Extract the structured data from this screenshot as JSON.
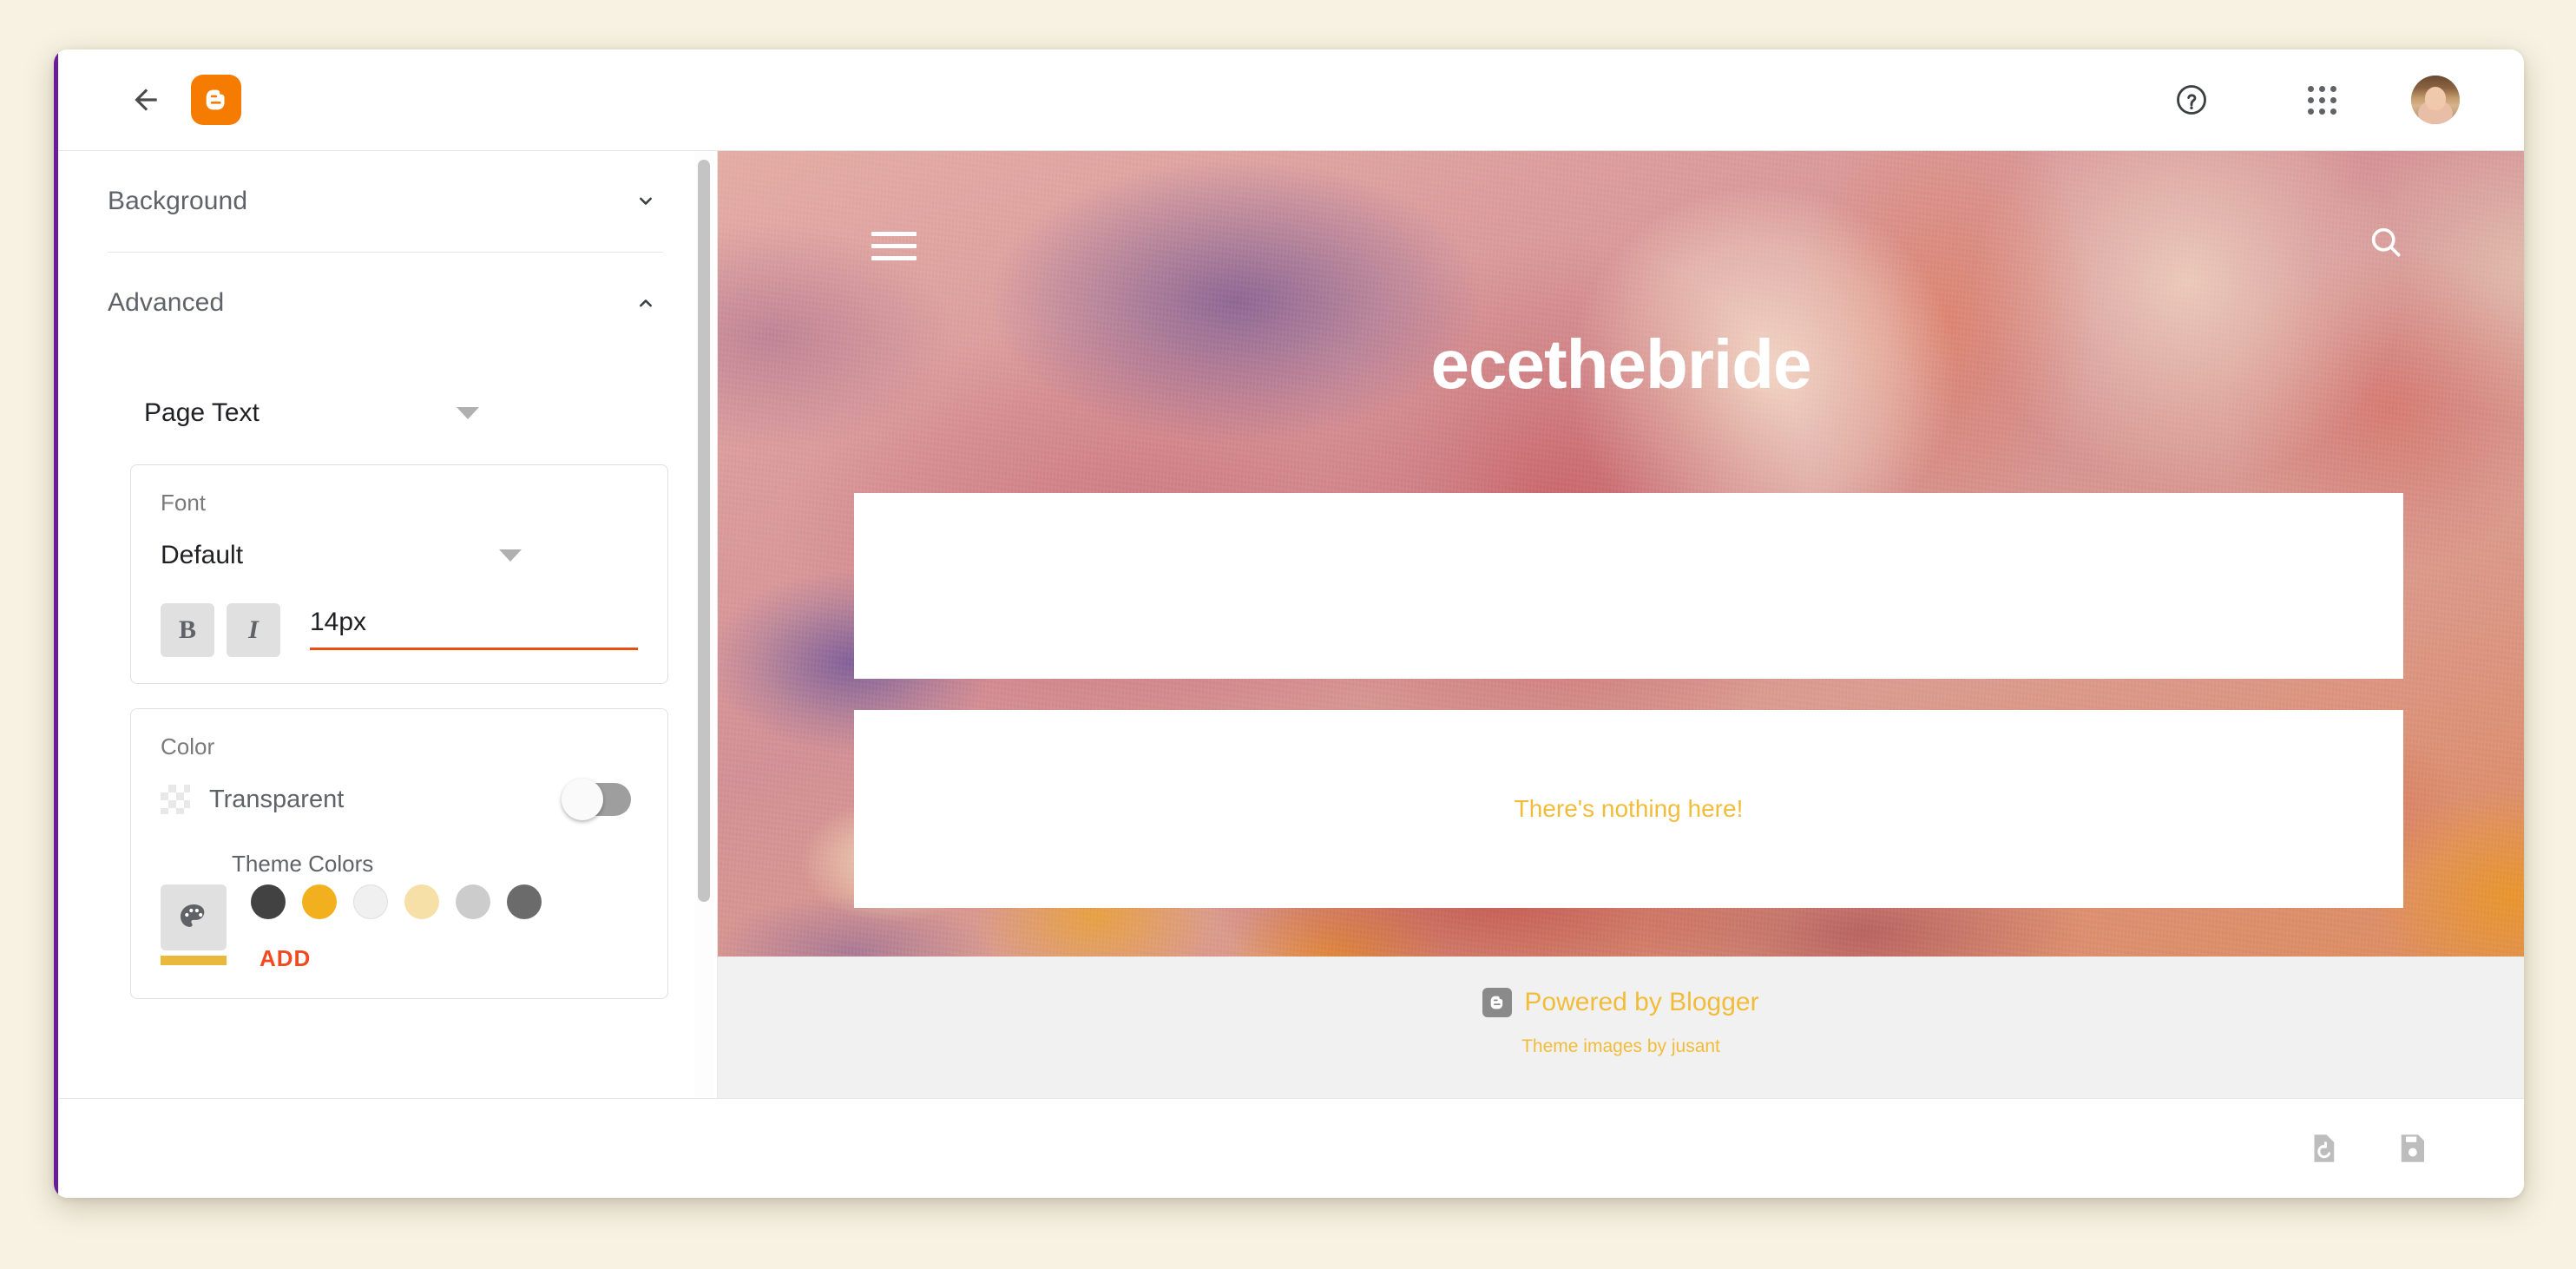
{
  "topbar": {
    "back_icon": "arrow-left-icon",
    "logo_icon": "blogger-logo-icon",
    "help_icon": "help-circle-icon",
    "apps_icon": "apps-grid-icon",
    "avatar_icon": "user-avatar"
  },
  "settings_panel": {
    "sections": [
      {
        "title": "Background",
        "expanded": false,
        "chevron": "chevron-down-icon"
      },
      {
        "title": "Advanced",
        "expanded": true,
        "chevron": "chevron-up-icon"
      }
    ],
    "section_select": {
      "value": "Page Text",
      "chevron": "triangle-down-icon"
    },
    "font_card": {
      "label": "Font",
      "family_value": "Default",
      "family_chevron": "triangle-down-icon",
      "bold_label": "B",
      "italic_label": "I",
      "size_value": "14px",
      "underline_color": "#e8500f"
    },
    "color_card": {
      "label": "Color",
      "transparent_label": "Transparent",
      "transparent_on": false,
      "theme_colors_label": "Theme Colors",
      "custom_color_icon": "palette-icon",
      "custom_color_current": "#e8b93a",
      "swatches": [
        "#424242",
        "#f2b01e",
        "#f0f0f0",
        "#f7dfa8",
        "#cccccc",
        "#6b6b6b"
      ],
      "add_label": "ADD"
    },
    "scrollbar": {
      "thumb_color": "#c4c4c4"
    }
  },
  "preview": {
    "menu_icon": "hamburger-menu-icon",
    "search_icon": "search-icon",
    "blog_title": "ecethebride",
    "empty_message": "There's nothing here!",
    "empty_message_color": "#f2bc3b",
    "footer": {
      "blogger_icon": "blogger-b-icon",
      "powered_by": "Powered by Blogger",
      "theme_credit": "Theme images by jusant",
      "link_color": "#f2bc3b",
      "background": "#f1f1f1"
    }
  },
  "bottom_bar": {
    "revert_icon": "revert-restore-icon",
    "save_icon": "save-floppy-icon"
  }
}
